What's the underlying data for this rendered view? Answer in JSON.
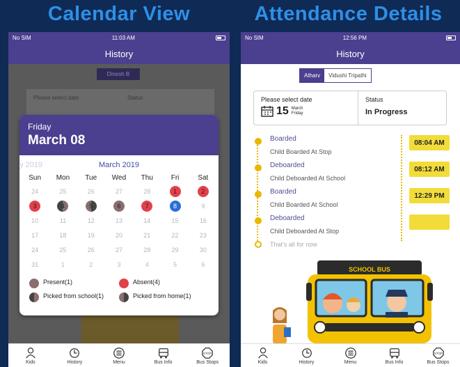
{
  "banners": {
    "left": "Calendar View",
    "right": "Attendance Details"
  },
  "left_phone": {
    "status": {
      "carrier": "No SIM",
      "time": "11:03 AM"
    },
    "nav_title": "History",
    "kid_tab": "Dinesh B",
    "card": {
      "select_label": "Please select date",
      "status_label": "Status"
    },
    "modal": {
      "weekday": "Friday",
      "date": "March 08",
      "ghost_year": "y 2019",
      "month": "March 2019",
      "weekdays": [
        "Sun",
        "Mon",
        "Tue",
        "Wed",
        "Thu",
        "Fri",
        "Sat"
      ],
      "days": [
        {
          "d": "24",
          "s": "out"
        },
        {
          "d": "25",
          "s": "out"
        },
        {
          "d": "26",
          "s": "out"
        },
        {
          "d": "27",
          "s": "out"
        },
        {
          "d": "28",
          "s": "out"
        },
        {
          "d": "1",
          "s": "absent"
        },
        {
          "d": "2",
          "s": "absent"
        },
        {
          "d": "3",
          "s": "absent"
        },
        {
          "d": "4",
          "s": "school"
        },
        {
          "d": "5",
          "s": "home"
        },
        {
          "d": "6",
          "s": "present"
        },
        {
          "d": "7",
          "s": "absent"
        },
        {
          "d": "8",
          "s": "today"
        },
        {
          "d": "9",
          "s": "in"
        },
        {
          "d": "10",
          "s": "in"
        },
        {
          "d": "11",
          "s": "in"
        },
        {
          "d": "12",
          "s": "in"
        },
        {
          "d": "13",
          "s": "in"
        },
        {
          "d": "14",
          "s": "in"
        },
        {
          "d": "15",
          "s": "in"
        },
        {
          "d": "16",
          "s": "in"
        },
        {
          "d": "17",
          "s": "in"
        },
        {
          "d": "18",
          "s": "in"
        },
        {
          "d": "19",
          "s": "in"
        },
        {
          "d": "20",
          "s": "in"
        },
        {
          "d": "21",
          "s": "in"
        },
        {
          "d": "22",
          "s": "in"
        },
        {
          "d": "23",
          "s": "in"
        },
        {
          "d": "24",
          "s": "in"
        },
        {
          "d": "25",
          "s": "in"
        },
        {
          "d": "26",
          "s": "in"
        },
        {
          "d": "27",
          "s": "in"
        },
        {
          "d": "28",
          "s": "in"
        },
        {
          "d": "29",
          "s": "in"
        },
        {
          "d": "30",
          "s": "in"
        },
        {
          "d": "31",
          "s": "in"
        },
        {
          "d": "1",
          "s": "out"
        },
        {
          "d": "2",
          "s": "out"
        },
        {
          "d": "3",
          "s": "out"
        },
        {
          "d": "4",
          "s": "out"
        },
        {
          "d": "5",
          "s": "out"
        },
        {
          "d": "6",
          "s": "out"
        }
      ],
      "legend": {
        "present": "Present(1)",
        "absent": "Absent(4)",
        "school": "Picked from school(1)",
        "home": "Picked from home(1)"
      }
    }
  },
  "right_phone": {
    "status": {
      "carrier": "No SIM",
      "time": "12:56 PM"
    },
    "nav_title": "History",
    "tabs": [
      "Atharv",
      "Vidushi Tripathi"
    ],
    "card": {
      "select_label": "Please select date",
      "day_num": "15",
      "month": "March",
      "weekday": "Friday",
      "status_label": "Status",
      "status_value": "In Progress"
    },
    "timeline": [
      {
        "title": "Boarded",
        "desc": "Child Boarded At Stop"
      },
      {
        "title": "Deboarded",
        "desc": "Child Deboarded At School"
      },
      {
        "title": "Boarded",
        "desc": "Child Boarded At School"
      },
      {
        "title": "Deboarded",
        "desc": "Child Deboarded At Stop"
      }
    ],
    "end_text": "That's all for now",
    "times": [
      "08:04 AM",
      "08:12 AM",
      "12:29 PM",
      ""
    ],
    "bus_sign": "SCHOOL BUS"
  },
  "tabbar": [
    "Kids",
    "History",
    "Menu",
    "Bus Info",
    "Bus Stops"
  ],
  "colors": {
    "nav": "#4b3f8f",
    "banner": "#2f8fe6",
    "absent": "#e2404a",
    "present": "#8a6f6f",
    "today": "#2a6fd6",
    "timeline": "#e8b800"
  }
}
